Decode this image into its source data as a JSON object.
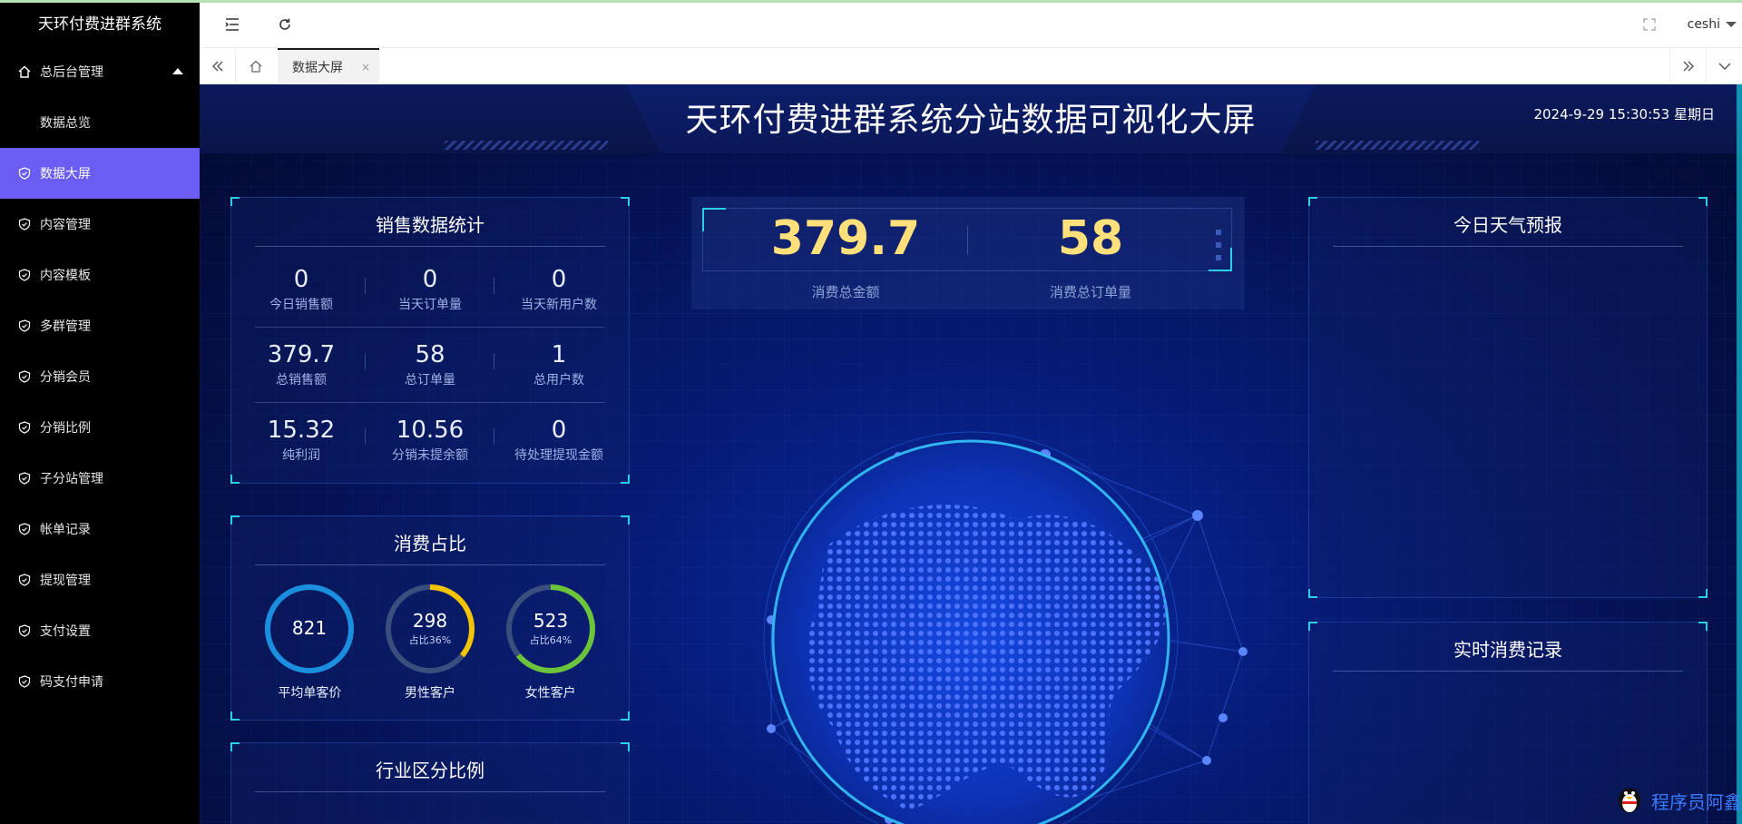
{
  "app": {
    "brand": "天环付费进群系统"
  },
  "sidebar": {
    "group": {
      "label": "总后台管理"
    },
    "items": [
      {
        "label": "数据总览",
        "sub": true
      },
      {
        "label": "数据大屏",
        "active": true
      },
      {
        "label": "内容管理"
      },
      {
        "label": "内容模板"
      },
      {
        "label": "多群管理"
      },
      {
        "label": "分销会员"
      },
      {
        "label": "分销比例"
      },
      {
        "label": "子分站管理"
      },
      {
        "label": "帐单记录"
      },
      {
        "label": "提现管理"
      },
      {
        "label": "支付设置"
      },
      {
        "label": "码支付申请"
      }
    ]
  },
  "topbar": {
    "user": "ceshi"
  },
  "tabs": [
    {
      "label": "数据大屏",
      "close": "×"
    }
  ],
  "dashboard": {
    "title": "天环付费进群系统分站数据可视化大屏",
    "datetime": "2024-9-29 15:30:53 星期日",
    "sales": {
      "title": "销售数据统计",
      "stats": [
        {
          "value": "0",
          "label": "今日销售额"
        },
        {
          "value": "0",
          "label": "当天订单量"
        },
        {
          "value": "0",
          "label": "当天新用户数"
        },
        {
          "value": "379.7",
          "label": "总销售额"
        },
        {
          "value": "58",
          "label": "总订单量"
        },
        {
          "value": "1",
          "label": "总用户数"
        },
        {
          "value": "15.32",
          "label": "纯利润"
        },
        {
          "value": "10.56",
          "label": "分销未提余额"
        },
        {
          "value": "0",
          "label": "待处理提现金额"
        }
      ]
    },
    "consumption": {
      "title": "消费占比",
      "donuts": [
        {
          "value": "821",
          "sub": "",
          "label": "平均单客价",
          "fraction": 1.0,
          "color": "#1a8fe0"
        },
        {
          "value": "298",
          "sub": "占比36%",
          "label": "男性客户",
          "fraction": 0.36,
          "color": "#f5c400"
        },
        {
          "value": "523",
          "sub": "占比64%",
          "label": "女性客户",
          "fraction": 0.64,
          "color": "#6cc43a"
        }
      ]
    },
    "industry": {
      "title": "行业区分比例"
    },
    "kpi": {
      "total_amount": "379.7",
      "total_amount_label": "消费总金额",
      "total_orders": "58",
      "total_orders_label": "消费总订单量"
    },
    "weather": {
      "title": "今日天气预报"
    },
    "records": {
      "title": "实时消费记录"
    },
    "watermark": "程序员阿鑫"
  },
  "colors": {
    "accent": "#6b5cf4",
    "kpi": "#ffe07a",
    "corner": "#2ad0e8"
  }
}
